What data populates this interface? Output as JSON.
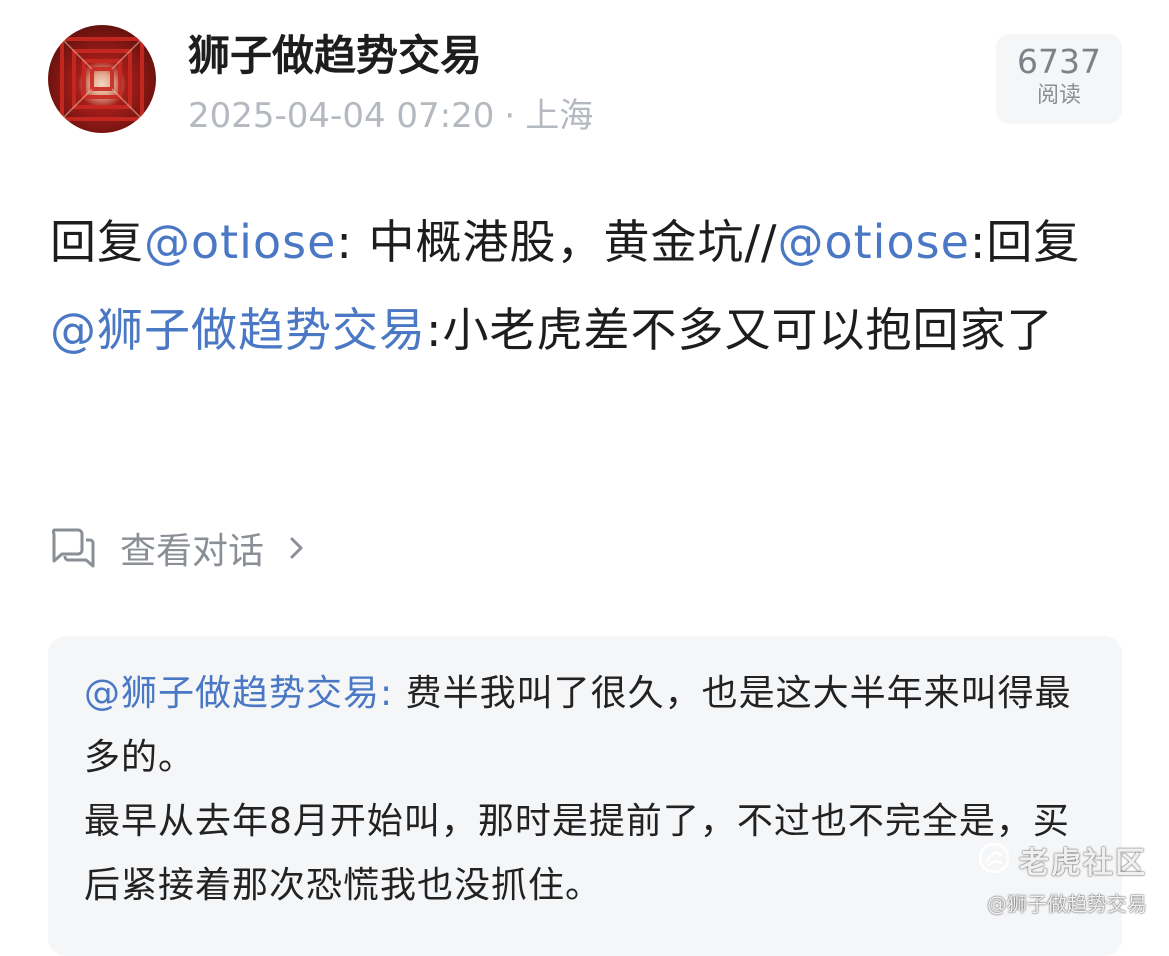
{
  "post": {
    "author": "狮子做趋势交易",
    "timestamp": "2025-04-04 07:20",
    "separator": "·",
    "location": "上海",
    "views": {
      "count": "6737",
      "label": "阅读"
    },
    "content": {
      "part1": "回复",
      "mention1": "@otiose",
      "part2": ": 中概港股，黄金坑//",
      "mention2": "@otiose",
      "part3": ":回复",
      "mention3": "@狮子做趋势交易",
      "part4": ":小老虎差不多又可以抱回家了"
    },
    "view_conversation": "查看对话"
  },
  "quoted": {
    "author": "@狮子做趋势交易:",
    "line1": "费半我叫了很久，也是这大半年来叫得最多的。",
    "line2": "最早从去年8月开始叫，那时是提前了，不过也不完全是，买后紧接着那次恐慌我也没抓住。"
  },
  "watermark": {
    "brand": "老虎社区",
    "user": "@狮子做趋势交易"
  },
  "colors": {
    "mention": "#4a78c4",
    "meta": "#b4b8bf",
    "quote_bg": "#f5f6f8"
  },
  "icons": [
    "avatar-image",
    "chat-bubbles-icon",
    "chevron-right-icon",
    "tiger-logo-icon"
  ]
}
